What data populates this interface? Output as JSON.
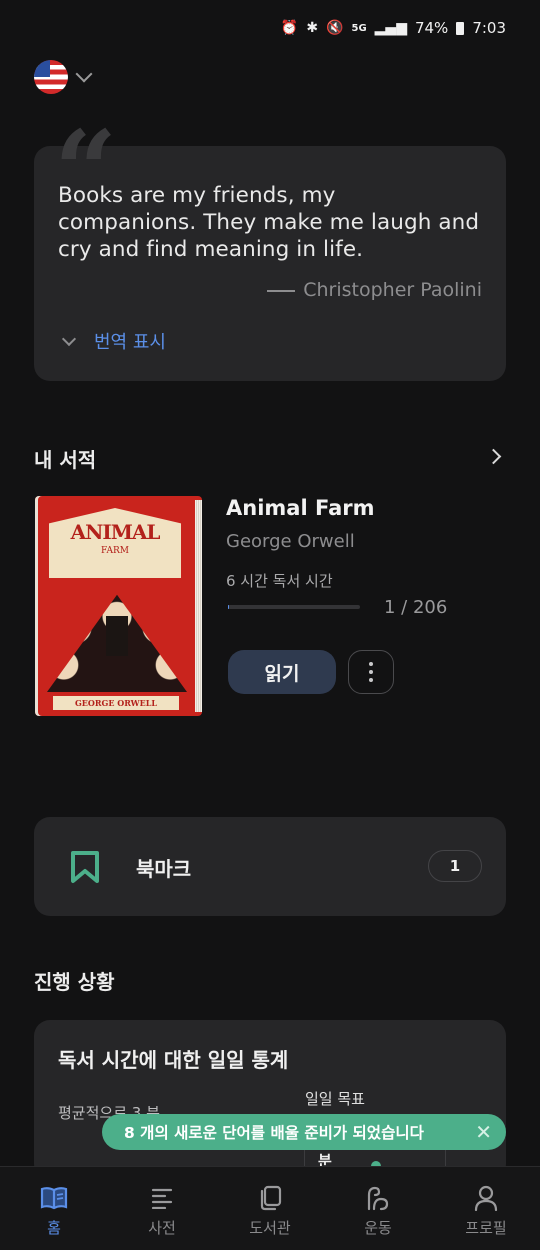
{
  "status_bar": {
    "network": "5G",
    "battery": "74%",
    "time": "7:03"
  },
  "language": {
    "current": "en-US",
    "flag_icon": "us-flag-icon"
  },
  "quote": {
    "text": "Books are my friends, my companions. They make me laugh and cry and find meaning in life.",
    "author": "Christopher Paolini",
    "translate_label": "번역 표시"
  },
  "my_books": {
    "section_title": "내 서적",
    "book": {
      "title": "Animal Farm",
      "author": "George Orwell",
      "reading_time": "6 시간 독서 시간",
      "progress_text": "1 / 206",
      "progress_fraction": 0.005,
      "read_label": "읽기",
      "cover": {
        "title": "ANIMAL",
        "subtitle": "FARM",
        "author": "GEORGE ORWELL"
      }
    }
  },
  "bookmarks": {
    "label": "북마크",
    "count": "1"
  },
  "progress_section": {
    "title": "진행 상황",
    "stats": {
      "title": "독서 시간에 대한 일일 통계",
      "average": "평균적으로 3 분",
      "goal_label": "일일 목표",
      "goal_unit": "분"
    }
  },
  "toast": {
    "message": "8 개의 새로운 단어를 배울 준비가 되었습니다"
  },
  "nav": {
    "items": [
      {
        "label": "홈",
        "icon": "book-open-icon",
        "active": true
      },
      {
        "label": "사전",
        "icon": "list-icon",
        "active": false
      },
      {
        "label": "도서관",
        "icon": "library-icon",
        "active": false
      },
      {
        "label": "운동",
        "icon": "muscle-icon",
        "active": false
      },
      {
        "label": "프로필",
        "icon": "profile-icon",
        "active": false
      }
    ]
  },
  "colors": {
    "accent": "#5b8fe8",
    "toast": "#4caf8a",
    "bookmark_icon": "#4caf8a",
    "background": "#121213",
    "card": "#262628"
  }
}
